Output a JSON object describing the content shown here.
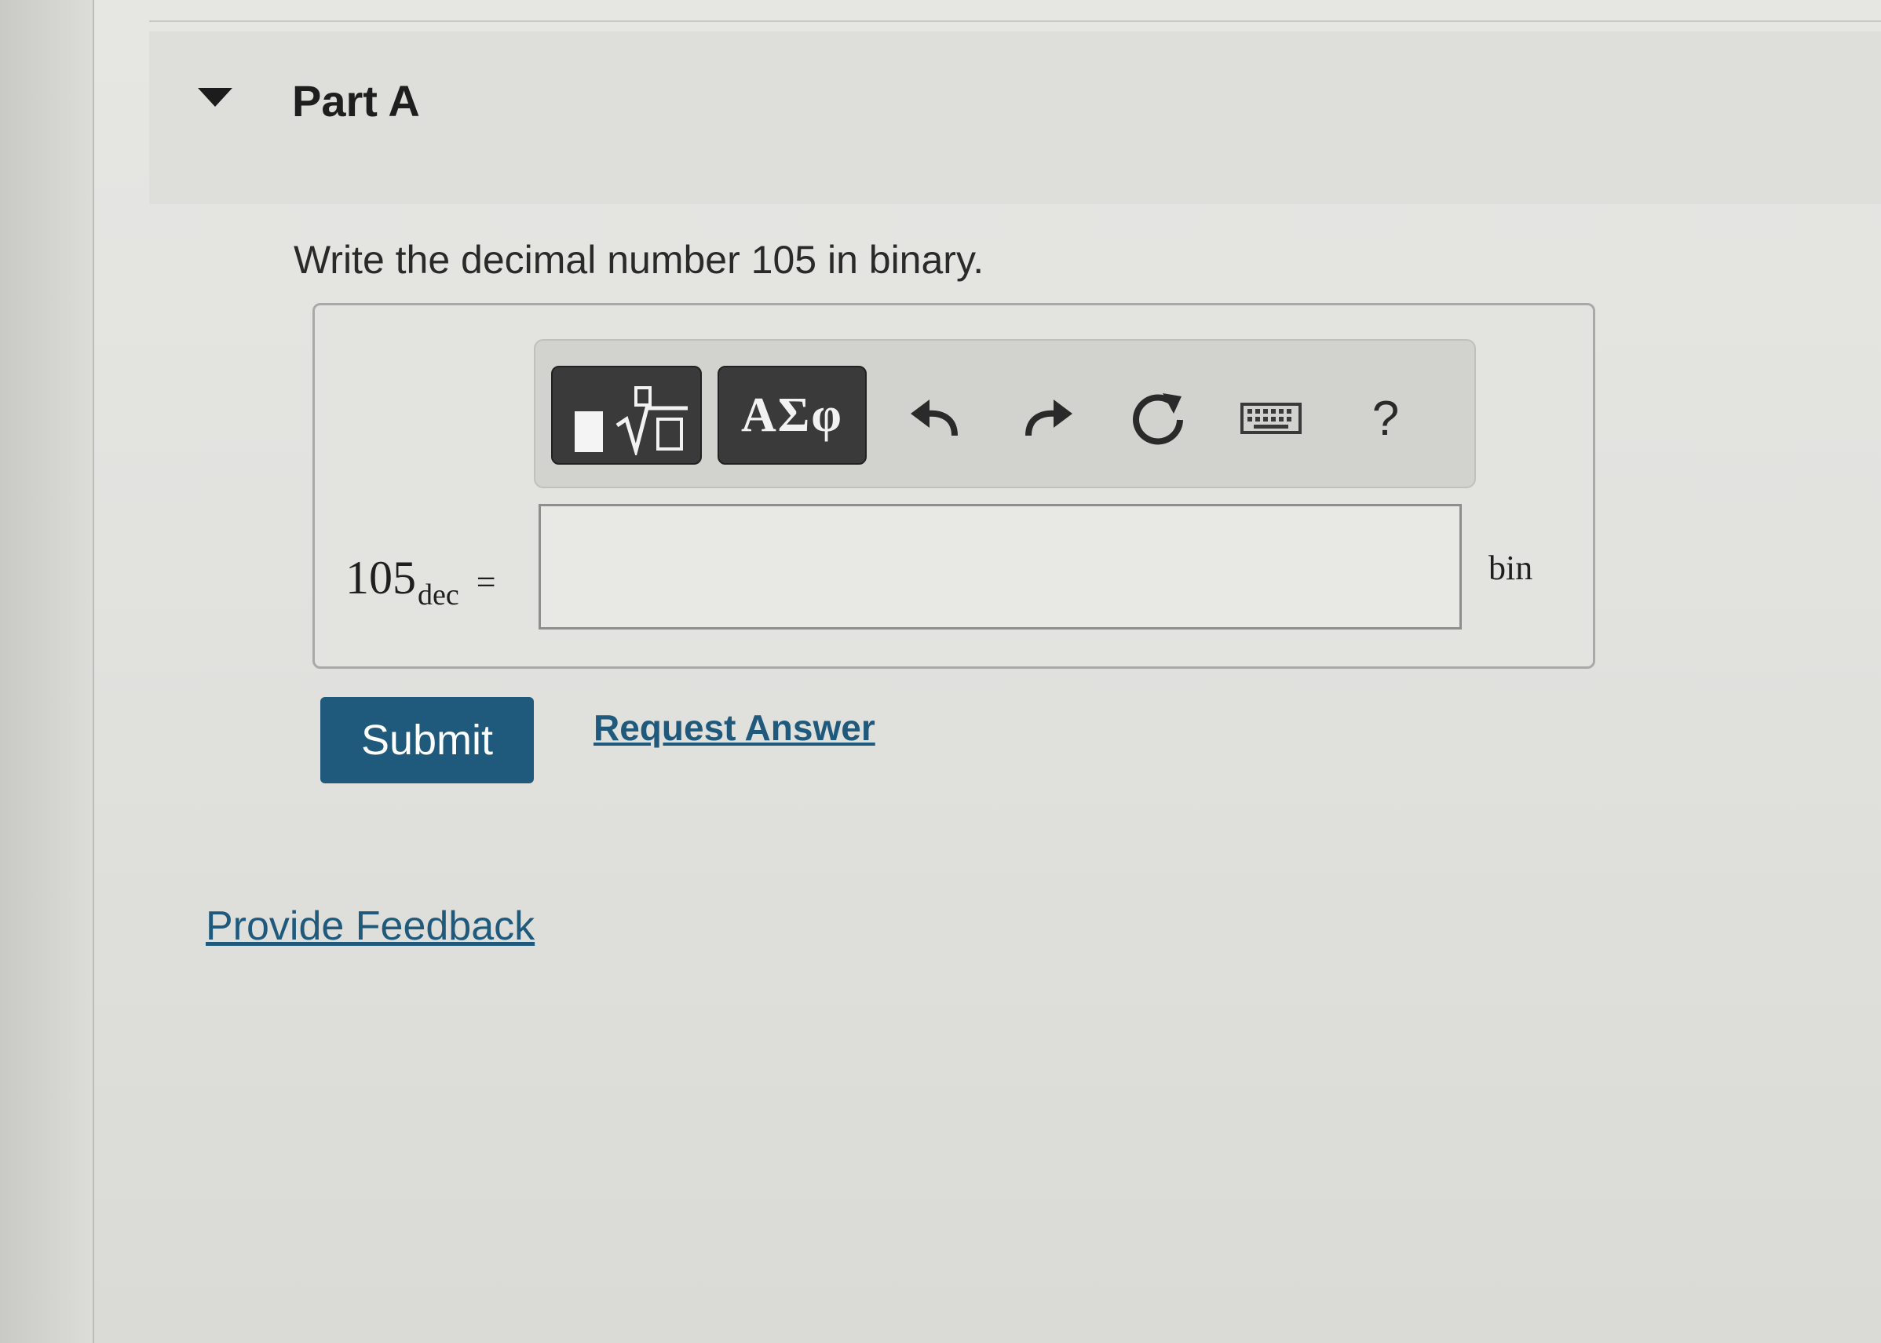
{
  "part": {
    "title": "Part A"
  },
  "question": {
    "text": "Write the decimal number 105 in binary."
  },
  "toolbar": {
    "templates_button": {
      "icon": "templates-radical-icon"
    },
    "greek_button": {
      "label": "ΑΣφ"
    },
    "undo": {
      "icon": "undo-icon"
    },
    "redo": {
      "icon": "redo-icon"
    },
    "reset": {
      "icon": "reset-icon"
    },
    "keyboard": {
      "icon": "keyboard-icon"
    },
    "help": {
      "label": "?"
    }
  },
  "answer": {
    "lhs_number": "105",
    "lhs_subscript": "dec",
    "lhs_equals": "=",
    "value": "",
    "unit": "bin"
  },
  "actions": {
    "submit_label": "Submit",
    "request_answer_label": "Request Answer"
  },
  "footer": {
    "feedback_label": "Provide Feedback"
  },
  "colors": {
    "primary": "#1f5a7c",
    "toolbar_dark": "#3a3a3a"
  }
}
